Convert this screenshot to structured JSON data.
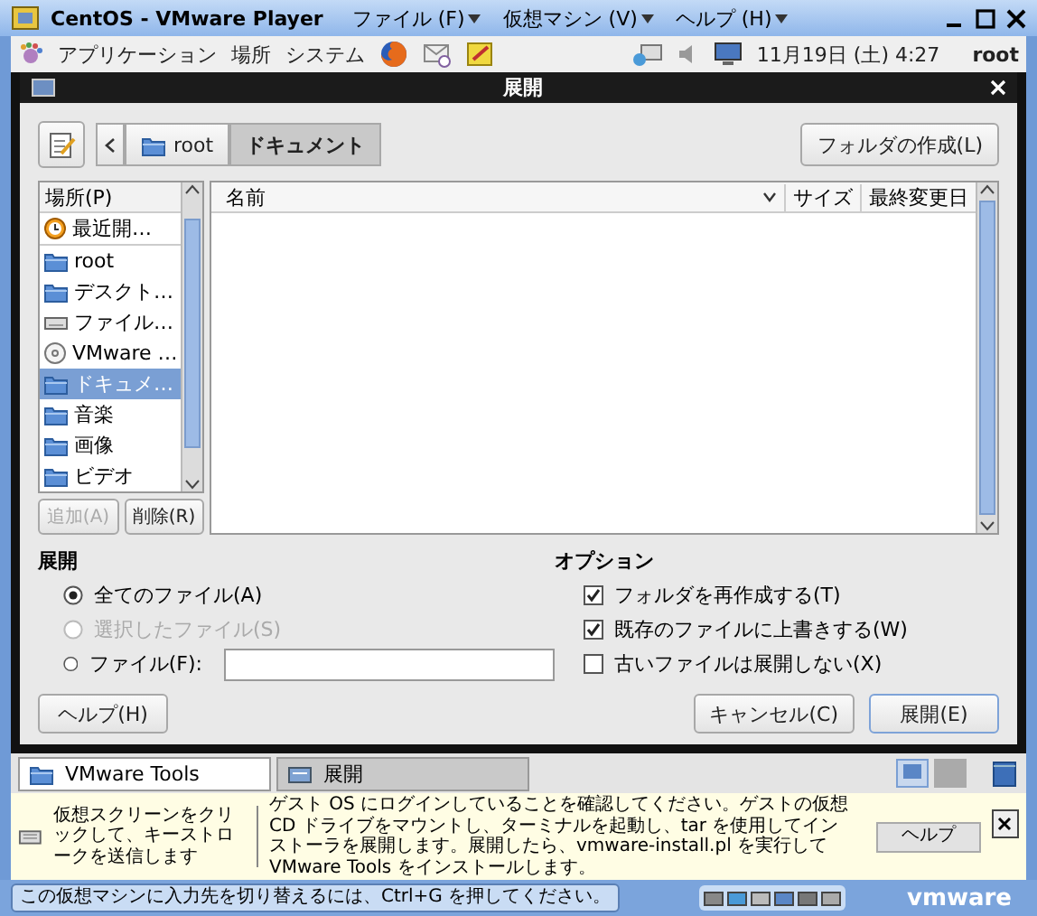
{
  "vmware_window": {
    "title": "CentOS - VMware Player",
    "menus": [
      "ファイル (F)",
      "仮想マシン (V)",
      "ヘルプ (H)"
    ]
  },
  "panel": {
    "menus": [
      "アプリケーション",
      "場所",
      "システム"
    ],
    "clock": "11月19日 (土) 4:27",
    "user": "root"
  },
  "dialog": {
    "title": "展開",
    "path": [
      {
        "label": "root",
        "selected": false
      },
      {
        "label": "ドキュメント",
        "selected": true
      }
    ],
    "create_folder_button": "フォルダの作成(L)",
    "places": {
      "header": "場所(P)",
      "items": [
        {
          "label": "最近開…",
          "kind": "recent",
          "selected": false
        },
        {
          "label": "root",
          "kind": "folder",
          "selected": false
        },
        {
          "label": "デスクト…",
          "kind": "folder",
          "selected": false
        },
        {
          "label": "ファイル…",
          "kind": "drive",
          "selected": false
        },
        {
          "label": "VMware …",
          "kind": "disc",
          "selected": false
        },
        {
          "label": "ドキュメ…",
          "kind": "folder",
          "selected": true
        },
        {
          "label": "音楽",
          "kind": "folder",
          "selected": false
        },
        {
          "label": "画像",
          "kind": "folder",
          "selected": false
        },
        {
          "label": "ビデオ",
          "kind": "folder",
          "selected": false
        }
      ]
    },
    "add_button": {
      "label": "追加(A)",
      "disabled": true
    },
    "remove_button": {
      "label": "削除(R)",
      "disabled": false
    },
    "columns": [
      "名前",
      "サイズ",
      "最終変更日"
    ],
    "extract": {
      "heading": "展開",
      "options": [
        {
          "label": "全てのファイル(A)",
          "kind": "plain",
          "selected": true,
          "disabled": false
        },
        {
          "label": "選択したファイル(S)",
          "kind": "plain",
          "selected": false,
          "disabled": true
        },
        {
          "label": "ファイル(F):",
          "kind": "field",
          "selected": false,
          "disabled": false
        }
      ]
    },
    "options": {
      "heading": "オプション",
      "items": [
        {
          "label": "フォルダを再作成する(T)",
          "checked": true
        },
        {
          "label": "既存のファイルに上書きする(W)",
          "checked": true
        },
        {
          "label": "古いファイルは展開しない(X)",
          "checked": false
        }
      ]
    },
    "help_button": "ヘルプ(H)",
    "buttons": [
      {
        "label": "キャンセル(C)",
        "default": false
      },
      {
        "label": "展開(E)",
        "default": true
      }
    ]
  },
  "taskbar": {
    "tasks": [
      {
        "label": "VMware Tools",
        "selected": true
      },
      {
        "label": "展開",
        "selected": false
      }
    ]
  },
  "infobar": {
    "hint": "仮想スクリーンをクリックして、キーストロークを送信します",
    "message": "ゲスト OS にログインしていることを確認してください。ゲストの仮想 CD ドライブをマウントし、ターミナルを起動し、tar を使用してインストーラを展開します。展開したら、vmware-install.pl を実行して VMware Tools をインストールします。",
    "button": "ヘルプ"
  },
  "status_bar": {
    "text": "この仮想マシンに入力先を切り替えるには、Ctrl+G を押してください。",
    "logo": "vmware"
  }
}
